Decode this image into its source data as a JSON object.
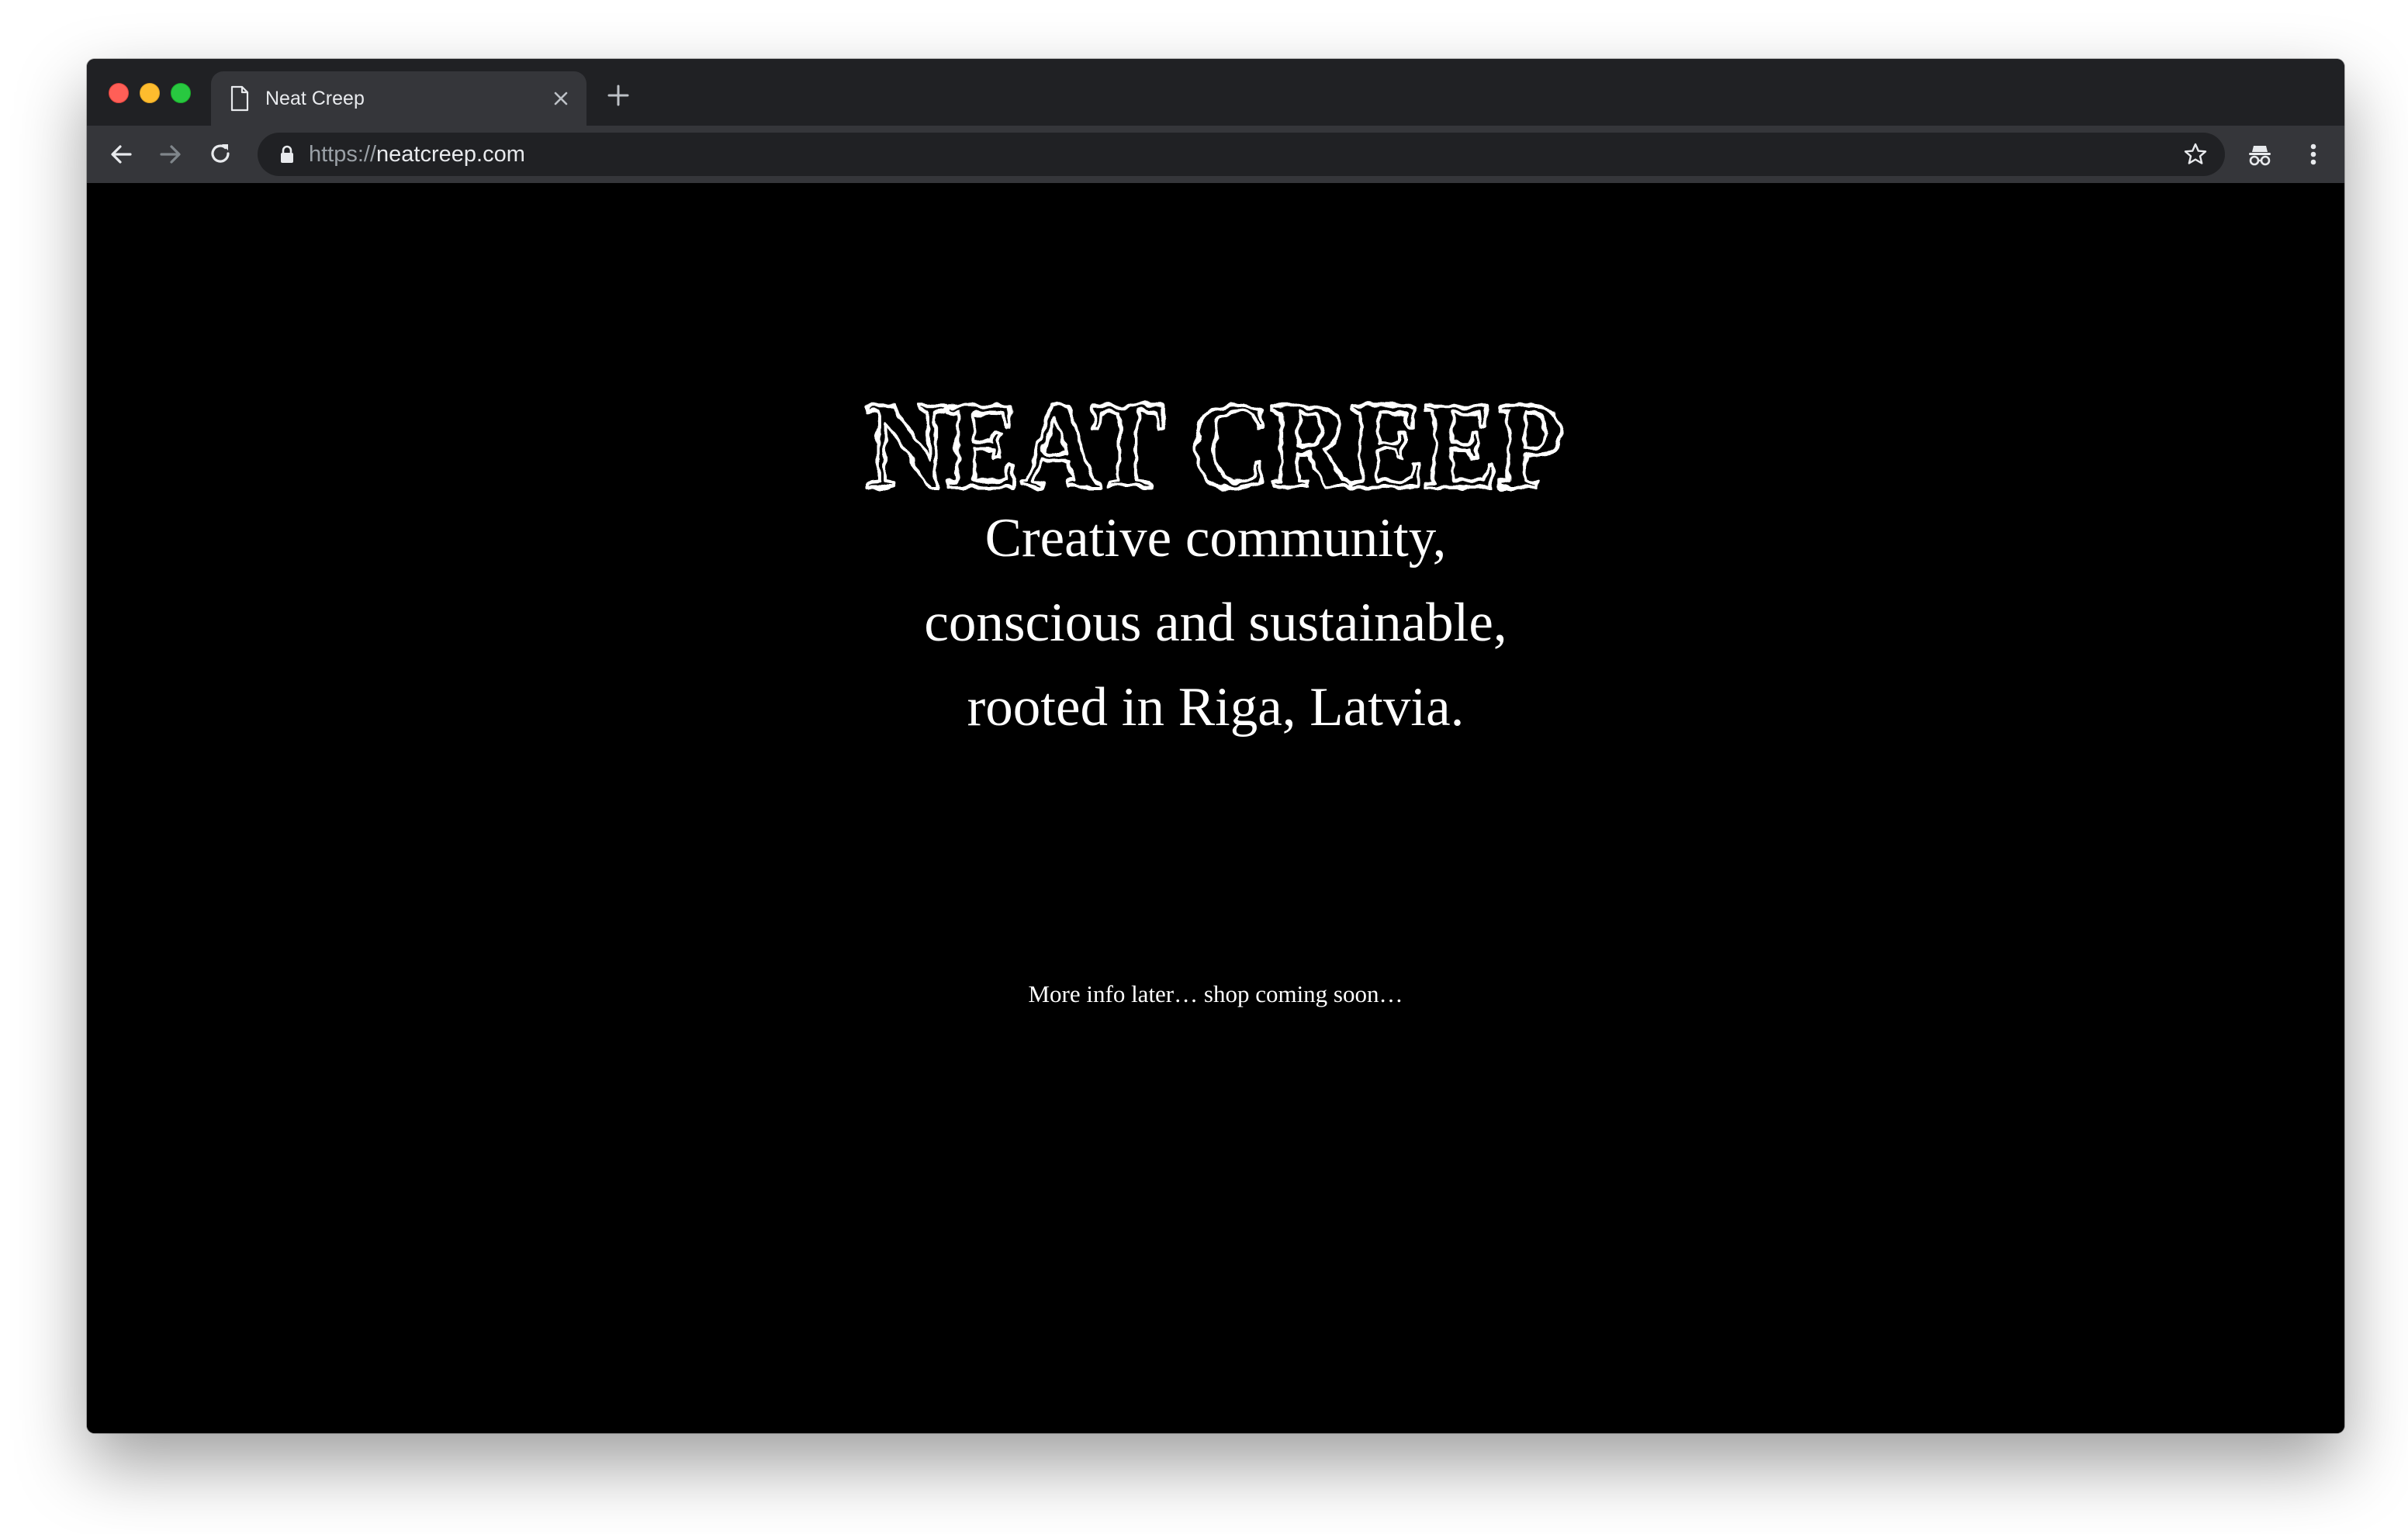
{
  "browser": {
    "tab": {
      "title": "Neat Creep",
      "icon": "document-icon"
    },
    "address_bar": {
      "scheme": "https://",
      "host": "neatcreep.com",
      "icon": "lock-icon"
    },
    "toolbar_icons": [
      "back-arrow-icon",
      "forward-arrow-icon",
      "reload-icon",
      "star-icon",
      "incognito-icon",
      "more-vert-icon"
    ],
    "colors": {
      "tabstrip": "#202124",
      "toolbar": "#35363a",
      "omnibox": "#202124",
      "page_background": "#000000"
    }
  },
  "page": {
    "logo_text": "NEAT CREEP",
    "tagline": [
      "Creative community,",
      "conscious and sustainable,",
      "rooted in Riga, Latvia."
    ],
    "note": "More info later… shop coming soon…",
    "text_color": "#ffffff"
  }
}
